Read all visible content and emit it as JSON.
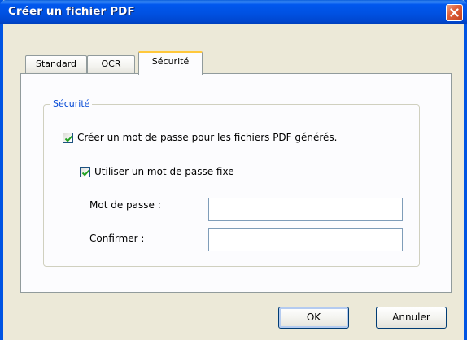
{
  "window": {
    "title": "Créer un fichier PDF",
    "close_icon": "close-icon"
  },
  "tabs": [
    {
      "label": "Standard",
      "selected": false
    },
    {
      "label": "OCR",
      "selected": false
    },
    {
      "label": "Sécurité",
      "selected": true
    }
  ],
  "security": {
    "group_title": "Sécurité",
    "create_password_label": "Créer un mot de passe pour les fichiers PDF générés.",
    "create_password_checked": true,
    "fixed_password_label": "Utiliser un mot de passe fixe",
    "fixed_password_checked": true,
    "password_label": "Mot de passe :",
    "password_value": "",
    "confirm_label": "Confirmer :",
    "confirm_value": ""
  },
  "buttons": {
    "ok": "OK",
    "cancel": "Annuler"
  },
  "colors": {
    "titlebar": "#0054E3",
    "dialog_bg": "#ECE9D8",
    "group_title": "#0046D5",
    "active_tab_accent": "#FFC83C",
    "checkmark": "#21A121"
  }
}
